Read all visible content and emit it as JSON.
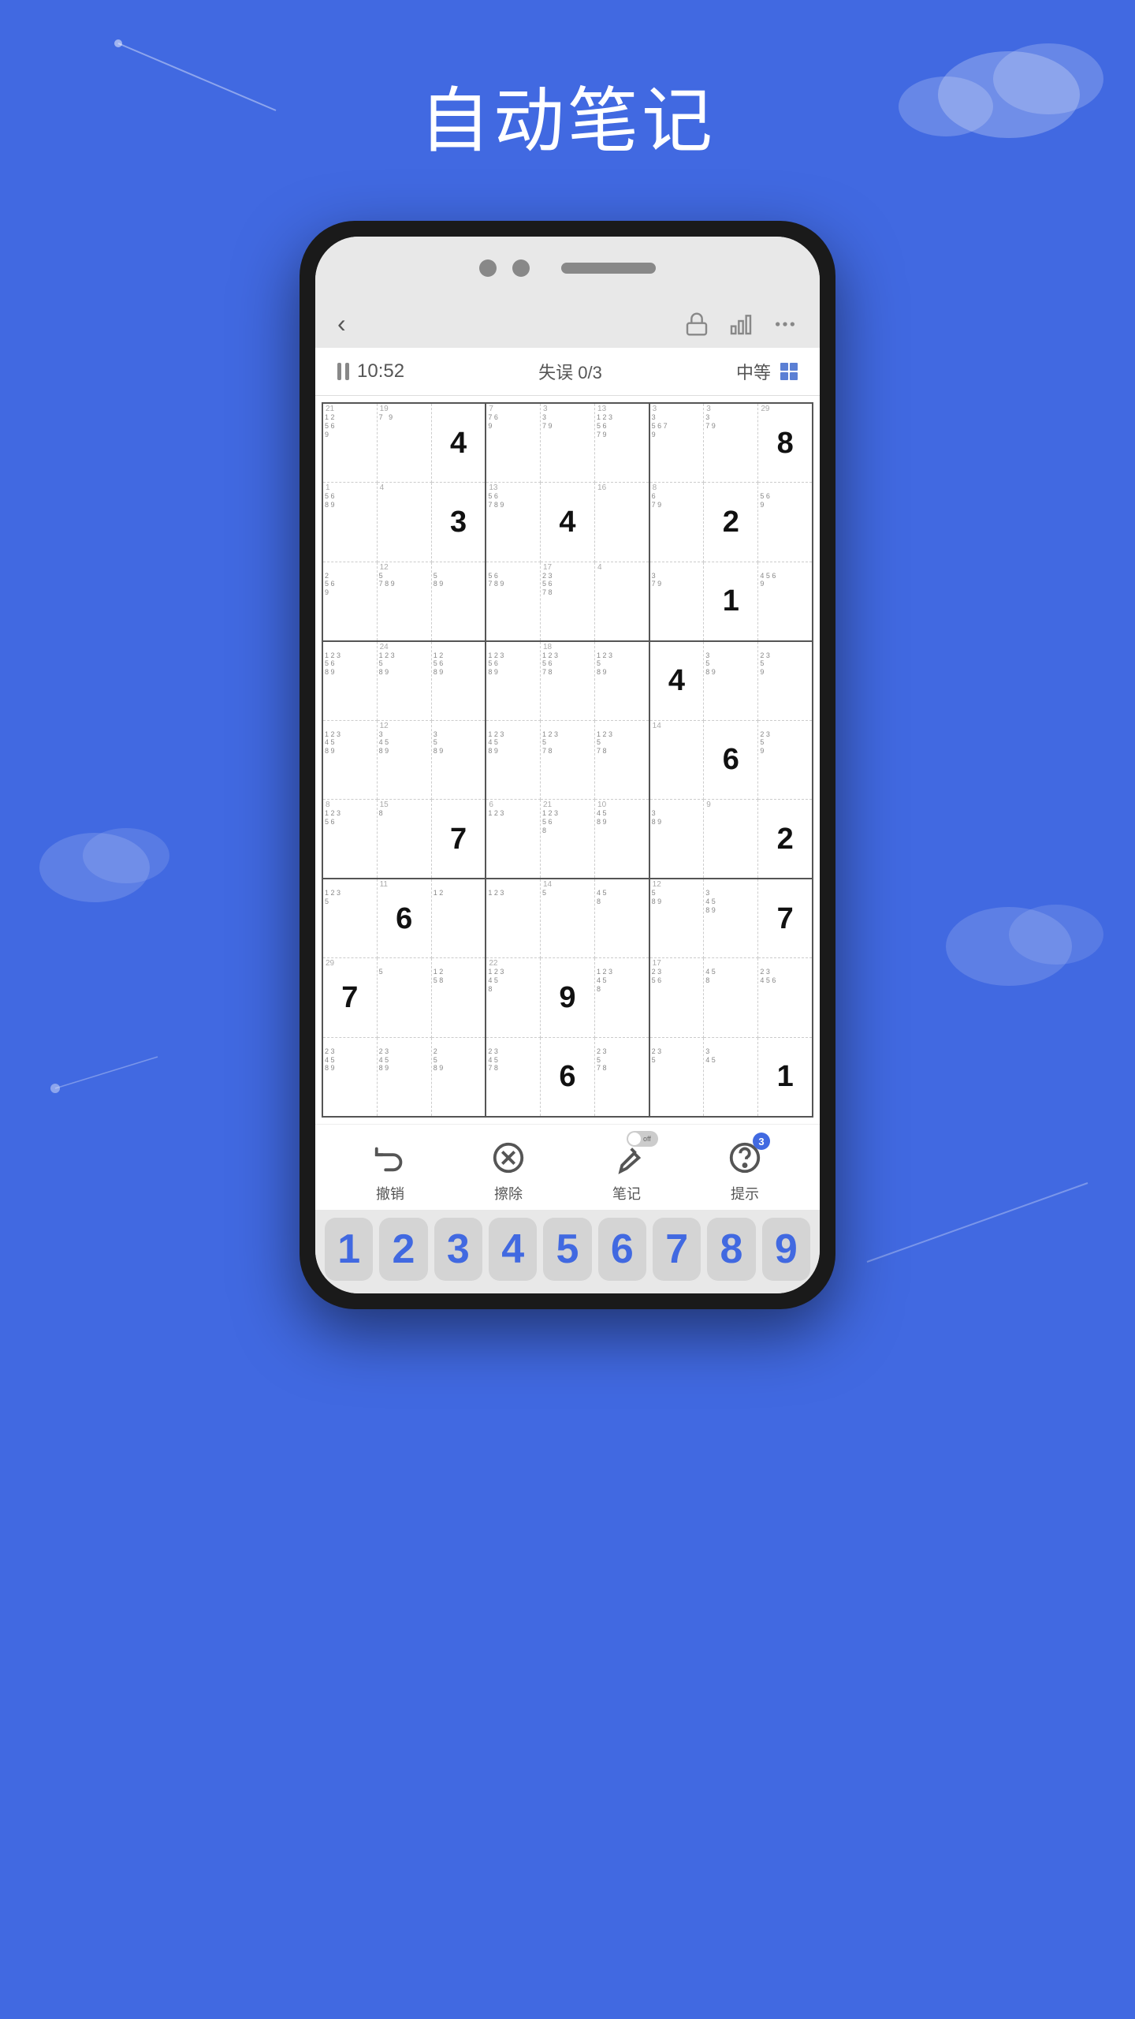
{
  "page": {
    "title": "自动笔记",
    "background_color": "#4169e1"
  },
  "header": {
    "back_label": "‹",
    "time": "10:52",
    "errors": "失误 0/3",
    "difficulty": "中等"
  },
  "toolbar": {
    "undo_label": "撤销",
    "erase_label": "擦除",
    "notes_label": "笔记",
    "hints_label": "提示",
    "hints_badge": "3",
    "notes_toggle": "off"
  },
  "numpad": {
    "numbers": [
      "1",
      "2",
      "3",
      "4",
      "5",
      "6",
      "7",
      "8",
      "9"
    ]
  },
  "sudoku": {
    "cells": [
      {
        "r": 0,
        "c": 0,
        "value": "",
        "notes": "1 2\n5 6\n9",
        "label": "21"
      },
      {
        "r": 0,
        "c": 1,
        "value": "",
        "notes": "7   9",
        "label": "19"
      },
      {
        "r": 0,
        "c": 2,
        "value": "4",
        "notes": "",
        "label": ""
      },
      {
        "r": 0,
        "c": 3,
        "value": "",
        "notes": "7 6\n9",
        "label": "7"
      },
      {
        "r": 0,
        "c": 4,
        "value": "",
        "notes": "3\n7 9",
        "label": "3"
      },
      {
        "r": 0,
        "c": 5,
        "value": "",
        "notes": "1 2 3\n5 6\n7 9",
        "label": "13"
      },
      {
        "r": 0,
        "c": 6,
        "value": "",
        "notes": "3\n5 6 7\n9",
        "label": "3"
      },
      {
        "r": 0,
        "c": 7,
        "value": "",
        "notes": "3\n7 9",
        "label": "3"
      },
      {
        "r": 0,
        "c": 8,
        "value": "8",
        "notes": "",
        "label": "29"
      },
      {
        "r": 1,
        "c": 0,
        "value": "",
        "notes": "5 6\n8 9",
        "label": "1"
      },
      {
        "r": 1,
        "c": 1,
        "value": "",
        "notes": "",
        "label": "4"
      },
      {
        "r": 1,
        "c": 2,
        "value": "3",
        "notes": "",
        "label": ""
      },
      {
        "r": 1,
        "c": 3,
        "value": "",
        "notes": "5 6\n7 8 9",
        "label": "13"
      },
      {
        "r": 1,
        "c": 4,
        "value": "4",
        "notes": "",
        "label": ""
      },
      {
        "r": 1,
        "c": 5,
        "value": "",
        "notes": "",
        "label": "16"
      },
      {
        "r": 1,
        "c": 6,
        "value": "",
        "notes": "6\n7 9",
        "label": "8"
      },
      {
        "r": 1,
        "c": 7,
        "value": "2",
        "notes": "",
        "label": ""
      },
      {
        "r": 1,
        "c": 8,
        "value": "",
        "notes": "5 6\n9",
        "label": ""
      },
      {
        "r": 2,
        "c": 0,
        "value": "",
        "notes": "2\n5 6\n9",
        "label": ""
      },
      {
        "r": 2,
        "c": 1,
        "value": "",
        "notes": "5\n7 8 9",
        "label": "12"
      },
      {
        "r": 2,
        "c": 2,
        "value": "",
        "notes": "5\n8 9",
        "label": ""
      },
      {
        "r": 2,
        "c": 3,
        "value": "",
        "notes": "5 6\n7 8 9",
        "label": ""
      },
      {
        "r": 2,
        "c": 4,
        "value": "",
        "notes": "2 3\n5 6\n7 8",
        "label": "17"
      },
      {
        "r": 2,
        "c": 5,
        "value": "",
        "notes": "",
        "label": "4"
      },
      {
        "r": 2,
        "c": 6,
        "value": "",
        "notes": "3\n7 9",
        "label": ""
      },
      {
        "r": 2,
        "c": 7,
        "value": "1",
        "notes": "",
        "label": ""
      },
      {
        "r": 2,
        "c": 8,
        "value": "",
        "notes": "4 5 6\n9",
        "label": ""
      },
      {
        "r": 3,
        "c": 0,
        "value": "",
        "notes": "1 2 3\n5 6\n8 9",
        "label": ""
      },
      {
        "r": 3,
        "c": 1,
        "value": "",
        "notes": "1 2 3\n5\n8 9",
        "label": "24"
      },
      {
        "r": 3,
        "c": 2,
        "value": "",
        "notes": "1 2\n5 6\n8 9",
        "label": ""
      },
      {
        "r": 3,
        "c": 3,
        "value": "",
        "notes": "1 2 3\n5 6\n8 9",
        "label": ""
      },
      {
        "r": 3,
        "c": 4,
        "value": "",
        "notes": "1 2 3\n5 6\n7 8",
        "label": "18"
      },
      {
        "r": 3,
        "c": 5,
        "value": "",
        "notes": "1 2 3\n5\n8 9",
        "label": ""
      },
      {
        "r": 3,
        "c": 6,
        "value": "4",
        "notes": "",
        "label": ""
      },
      {
        "r": 3,
        "c": 7,
        "value": "",
        "notes": "3\n5\n8 9",
        "label": ""
      },
      {
        "r": 3,
        "c": 8,
        "value": "",
        "notes": "2 3\n5\n9",
        "label": ""
      },
      {
        "r": 4,
        "c": 0,
        "value": "",
        "notes": "1 2 3\n4 5\n8 9",
        "label": ""
      },
      {
        "r": 4,
        "c": 1,
        "value": "",
        "notes": "3\n4 5\n8 9",
        "label": "12"
      },
      {
        "r": 4,
        "c": 2,
        "value": "",
        "notes": "3\n5\n8 9",
        "label": ""
      },
      {
        "r": 4,
        "c": 3,
        "value": "",
        "notes": "1 2 3\n4 5\n8 9",
        "label": ""
      },
      {
        "r": 4,
        "c": 4,
        "value": "",
        "notes": "1 2 3\n5\n7 8",
        "label": ""
      },
      {
        "r": 4,
        "c": 5,
        "value": "",
        "notes": "1 2 3\n5\n7 8",
        "label": ""
      },
      {
        "r": 4,
        "c": 6,
        "value": "",
        "notes": "",
        "label": "14"
      },
      {
        "r": 4,
        "c": 7,
        "value": "6",
        "notes": "",
        "label": ""
      },
      {
        "r": 4,
        "c": 8,
        "value": "",
        "notes": "2 3\n5\n9",
        "label": ""
      },
      {
        "r": 5,
        "c": 0,
        "value": "",
        "notes": "1 2 3\n5 6\n",
        "label": "8"
      },
      {
        "r": 5,
        "c": 1,
        "value": "",
        "notes": "8",
        "label": "15"
      },
      {
        "r": 5,
        "c": 2,
        "value": "7",
        "notes": "",
        "label": ""
      },
      {
        "r": 5,
        "c": 3,
        "value": "",
        "notes": "1 2 3",
        "label": "6"
      },
      {
        "r": 5,
        "c": 4,
        "value": "",
        "notes": "1 2 3\n5 6\n8",
        "label": "21"
      },
      {
        "r": 5,
        "c": 5,
        "value": "",
        "notes": "4 5\n8 9",
        "label": "10"
      },
      {
        "r": 5,
        "c": 6,
        "value": "",
        "notes": "3\n8 9",
        "label": ""
      },
      {
        "r": 5,
        "c": 7,
        "value": "",
        "notes": "",
        "label": "9"
      },
      {
        "r": 5,
        "c": 8,
        "value": "2",
        "notes": "",
        "label": ""
      },
      {
        "r": 6,
        "c": 0,
        "value": "",
        "notes": "1 2 3\n5",
        "label": ""
      },
      {
        "r": 6,
        "c": 1,
        "value": "6",
        "notes": "",
        "label": "11"
      },
      {
        "r": 6,
        "c": 2,
        "value": "",
        "notes": "1 2",
        "label": ""
      },
      {
        "r": 6,
        "c": 3,
        "value": "",
        "notes": "1 2 3",
        "label": ""
      },
      {
        "r": 6,
        "c": 4,
        "value": "",
        "notes": "5",
        "label": "14"
      },
      {
        "r": 6,
        "c": 5,
        "value": "",
        "notes": "4 5\n8",
        "label": ""
      },
      {
        "r": 6,
        "c": 6,
        "value": "",
        "notes": "5\n8 9",
        "label": "12"
      },
      {
        "r": 6,
        "c": 7,
        "value": "",
        "notes": "3\n4 5\n8 9",
        "label": ""
      },
      {
        "r": 6,
        "c": 8,
        "value": "7",
        "notes": "",
        "label": ""
      },
      {
        "r": 7,
        "c": 0,
        "value": "7",
        "notes": "",
        "label": "29"
      },
      {
        "r": 7,
        "c": 1,
        "value": "",
        "notes": "5",
        "label": ""
      },
      {
        "r": 7,
        "c": 2,
        "value": "",
        "notes": "1 2\n5 8",
        "label": ""
      },
      {
        "r": 7,
        "c": 3,
        "value": "",
        "notes": "1 2 3\n4 5\n8",
        "label": "22"
      },
      {
        "r": 7,
        "c": 4,
        "value": "9",
        "notes": "",
        "label": ""
      },
      {
        "r": 7,
        "c": 5,
        "value": "",
        "notes": "1 2 3\n4 5\n8",
        "label": ""
      },
      {
        "r": 7,
        "c": 6,
        "value": "",
        "notes": "2 3\n5 6\n",
        "label": "17"
      },
      {
        "r": 7,
        "c": 7,
        "value": "",
        "notes": "4 5\n8",
        "label": ""
      },
      {
        "r": 7,
        "c": 8,
        "value": "",
        "notes": "2 3\n4 5 6",
        "label": ""
      },
      {
        "r": 8,
        "c": 0,
        "value": "",
        "notes": "2 3\n4 5\n8 9",
        "label": ""
      },
      {
        "r": 8,
        "c": 1,
        "value": "",
        "notes": "2 3\n4 5\n8 9",
        "label": ""
      },
      {
        "r": 8,
        "c": 2,
        "value": "",
        "notes": "2\n5\n8 9",
        "label": ""
      },
      {
        "r": 8,
        "c": 3,
        "value": "",
        "notes": "2 3\n4 5\n7 8",
        "label": ""
      },
      {
        "r": 8,
        "c": 4,
        "value": "6",
        "notes": "",
        "label": ""
      },
      {
        "r": 8,
        "c": 5,
        "value": "",
        "notes": "2 3\n5\n7 8",
        "label": ""
      },
      {
        "r": 8,
        "c": 6,
        "value": "",
        "notes": "2 3\n5",
        "label": ""
      },
      {
        "r": 8,
        "c": 7,
        "value": "",
        "notes": "3\n4 5",
        "label": ""
      },
      {
        "r": 8,
        "c": 8,
        "value": "1",
        "notes": "",
        "label": ""
      }
    ]
  }
}
